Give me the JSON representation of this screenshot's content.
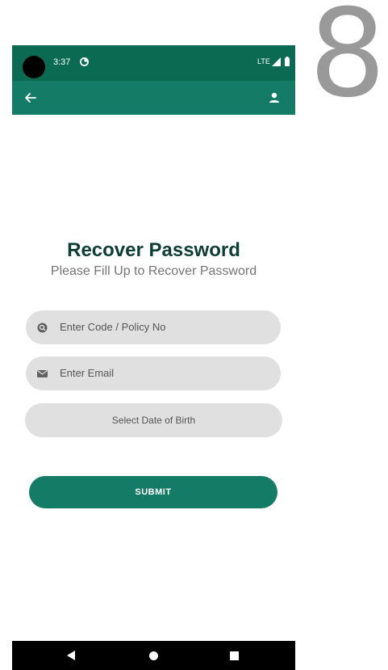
{
  "corner_label": "8",
  "status_bar": {
    "time": "3:37",
    "network": "LTE",
    "app_icon": "data-saver-icon",
    "signal_icon": "signal-icon",
    "battery_icon": "battery-icon"
  },
  "app_bar": {
    "back_icon": "arrow-back-icon",
    "profile_icon": "person-icon",
    "color": "#147b66"
  },
  "page": {
    "title": "Recover Password",
    "subtitle": "Please Fill Up to Recover Password"
  },
  "form": {
    "code_field": {
      "placeholder": "Enter Code / Policy No",
      "value": "",
      "icon": "search-id-icon"
    },
    "email_field": {
      "placeholder": "Enter Email",
      "value": "",
      "icon": "mail-icon"
    },
    "dob_field": {
      "label": "Select Date of Birth"
    },
    "submit_label": "SUBMIT"
  },
  "nav_bar": {
    "back": "nav-back-icon",
    "home": "nav-home-icon",
    "recents": "nav-recents-icon"
  },
  "colors": {
    "status_bar": "#0b6b52",
    "primary": "#147b66",
    "title": "#0d3d34",
    "field_bg": "#e0e0e0"
  }
}
